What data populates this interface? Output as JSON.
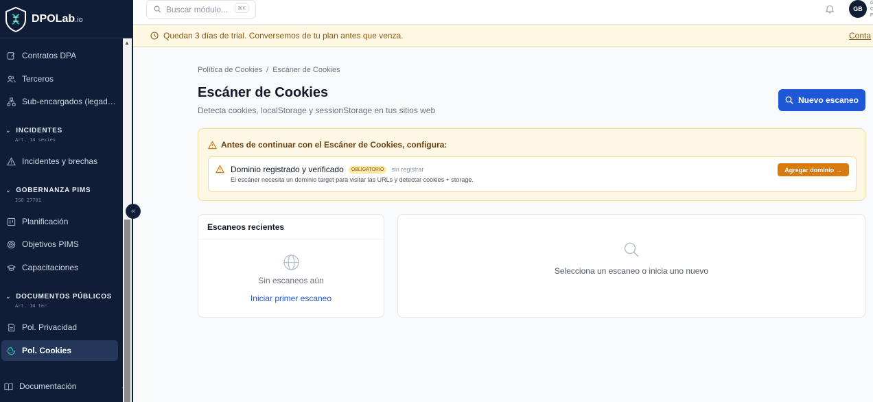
{
  "app": {
    "brand": "DPOLab",
    "brand_suffix": ".io"
  },
  "sidebar": {
    "items": [
      {
        "label": "Contratos DPA",
        "icon": "edit-document-icon"
      },
      {
        "label": "Terceros",
        "icon": "users-icon"
      },
      {
        "label": "Sub-encargados (legad…",
        "icon": "network-icon"
      },
      {
        "label": "Incidentes y brechas",
        "icon": "warning-triangle-icon"
      },
      {
        "label": "Planificación",
        "icon": "kanban-icon"
      },
      {
        "label": "Objetivos PIMS",
        "icon": "target-icon"
      },
      {
        "label": "Capacitaciones",
        "icon": "graduation-cap-icon"
      },
      {
        "label": "Pol. Privacidad",
        "icon": "document-icon"
      },
      {
        "label": "Pol. Cookies",
        "icon": "cookie-icon"
      }
    ],
    "sections": [
      {
        "title": "INCIDENTES",
        "sub": "Art. 14 sexies"
      },
      {
        "title": "GOBERNANZA PIMS",
        "sub": "ISO 27701"
      },
      {
        "title": "DOCUMENTOS PÚBLICOS",
        "sub": "Art. 14 ter"
      }
    ],
    "footer_link": "Documentación"
  },
  "topbar": {
    "search_placeholder": "Buscar módulo...",
    "shortcut": "⌘K",
    "avatar_initials": "GB",
    "user_fragment": [
      "G",
      "C",
      "F"
    ]
  },
  "banner": {
    "text": "Quedan 3 días de trial. Conversemos de tu plan antes que venza.",
    "link": "Conta"
  },
  "breadcrumb": {
    "parent": "Política de Cookies",
    "separator": "/",
    "current": "Escáner de Cookies"
  },
  "page": {
    "title": "Escáner de Cookies",
    "subtitle": "Detecta cookies, localStorage y sessionStorage en tus sitios web",
    "primary_button": "Nuevo escaneo"
  },
  "warning": {
    "title": "Antes de continuar con el Escáner de Cookies, configura:",
    "requirement": {
      "title": "Dominio registrado y verificado",
      "badge": "OBLIGATORIO",
      "status": "sin registrar",
      "description": "El escáner necesita un dominio target para visitar las URLs y detectar cookies + storage.",
      "button": "Agregar dominio →"
    }
  },
  "recent_scans": {
    "title": "Escaneos recientes",
    "empty_text": "Sin escaneos aún",
    "cta": "Iniciar primer escaneo"
  },
  "detail_panel": {
    "empty_text": "Selecciona un escaneo o inicia uno nuevo"
  },
  "colors": {
    "sidebar_bg": "#0f1e36",
    "primary": "#1f58d6",
    "warning_bg": "#fdf8e6",
    "accent_orange": "#d77a0f"
  }
}
